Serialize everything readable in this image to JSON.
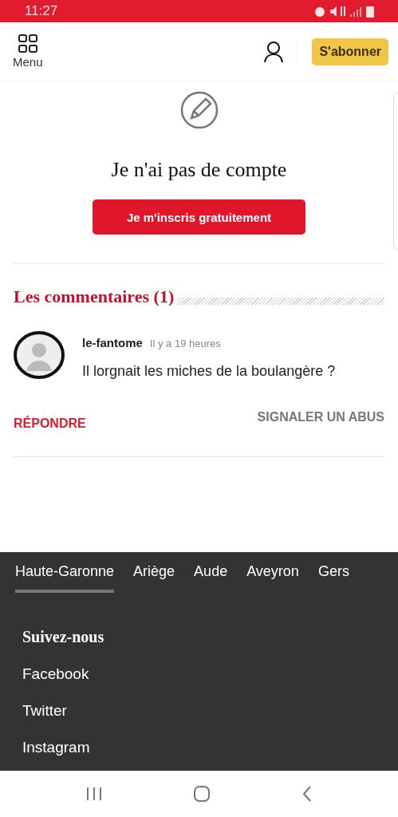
{
  "status_bar": {
    "time": "11:27"
  },
  "header": {
    "menu_label": "Menu",
    "subscribe": "S'abonner"
  },
  "signup": {
    "heading": "Je n'ai pas de compte",
    "button": "Je m'inscris gratuitement"
  },
  "comments": {
    "title": "Les commentaires (1)",
    "items": [
      {
        "author": "le-fantome",
        "time": "Il y a 19 heures",
        "text": "Il lorgnait les miches de la boulangère ?",
        "reply": "RÉPONDRE",
        "report": "SIGNALER UN ABUS"
      }
    ]
  },
  "footer": {
    "tabs": [
      {
        "label": "Haute-Garonne",
        "selected": true
      },
      {
        "label": "Ariège",
        "selected": false
      },
      {
        "label": "Aude",
        "selected": false
      },
      {
        "label": "Aveyron",
        "selected": false
      },
      {
        "label": "Gers",
        "selected": false
      }
    ],
    "follow_title": "Suivez-nous",
    "links": [
      "Facebook",
      "Twitter",
      "Instagram"
    ]
  }
}
